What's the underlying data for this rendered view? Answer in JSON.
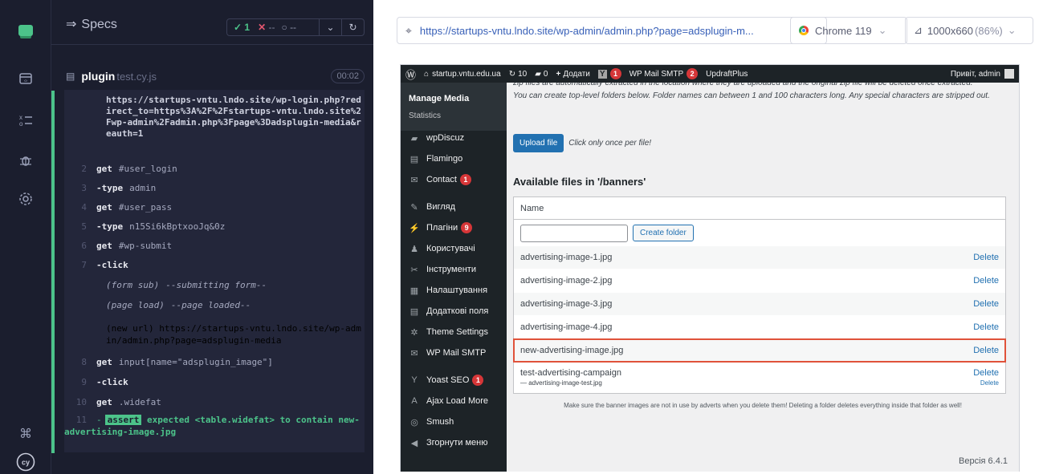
{
  "specs": {
    "title": "Specs",
    "passed": "1",
    "failed": "--",
    "pending": "--",
    "file_name": "plugin",
    "file_ext": "test.cy.js",
    "duration": "00:02",
    "redirect_text": "https://startups-vntu.lndo.site/wp-login.php?redirect_to=https%3A%2F%2Fstartups-vntu.lndo.site%2Fwp-admin%2Fadmin.php%3Fpage%3Dadsplugin-media&reauth=1",
    "commands": [
      {
        "num": "2",
        "name": "get",
        "value": "#user_login"
      },
      {
        "num": "3",
        "name": "-type",
        "value": "admin"
      },
      {
        "num": "4",
        "name": "get",
        "value": "#user_pass"
      },
      {
        "num": "5",
        "name": "-type",
        "value": "n15Si6kBptxooJq&0z"
      },
      {
        "num": "6",
        "name": "get",
        "value": "#wp-submit"
      },
      {
        "num": "7",
        "name": "-click",
        "value": ""
      },
      {
        "num": "",
        "name": "(form sub)",
        "value": "--submitting form--"
      },
      {
        "num": "",
        "name": "(page load)",
        "value": "--page loaded--"
      },
      {
        "num": "",
        "name": "(new url)",
        "value": "https://startups-vntu.lndo.site/wp-admin/admin.php?page=adsplugin-media"
      },
      {
        "num": "8",
        "name": "get",
        "value": "input[name=\"adsplugin_image\"]"
      },
      {
        "num": "9",
        "name": "-click",
        "value": ""
      },
      {
        "num": "10",
        "name": "get",
        "value": ".widefat"
      },
      {
        "num": "11",
        "name": "-",
        "badge": "assert",
        "value": "expected <table.widefat> to contain new-advertising-image.jpg"
      }
    ]
  },
  "browser": {
    "url": "https://startups-vntu.lndo.site/wp-admin/admin.php?page=adsplugin-m...",
    "browser_name": "Chrome 119",
    "viewport": "1000x660",
    "zoom": "(86%)"
  },
  "wp": {
    "adminbar": {
      "site": "startup.vntu.edu.ua",
      "updates": "10",
      "comments": "0",
      "add_new": "Додати",
      "yoast_count": "1",
      "smtp": "WP Mail SMTP",
      "smtp_count": "2",
      "updraft": "UpdraftPlus",
      "greeting": "Привіт, admin"
    },
    "menu": {
      "manage_media": "Manage Media",
      "statistics": "Statistics",
      "items": [
        {
          "label": "wpDiscuz",
          "icon": "comment-icon",
          "glyph": "▰"
        },
        {
          "label": "Flamingo",
          "icon": "flamingo-icon",
          "glyph": "▤"
        },
        {
          "label": "Contact",
          "icon": "mail-icon",
          "glyph": "✉",
          "badge": "1"
        },
        {
          "label": "Вигляд",
          "icon": "brush-icon",
          "glyph": "✎"
        },
        {
          "label": "Плагіни",
          "icon": "plugin-icon",
          "glyph": "⚡",
          "badge": "9"
        },
        {
          "label": "Користувачі",
          "icon": "users-icon",
          "glyph": "♟"
        },
        {
          "label": "Інструменти",
          "icon": "wrench-icon",
          "glyph": "✂"
        },
        {
          "label": "Налаштування",
          "icon": "settings-icon",
          "glyph": "▦"
        },
        {
          "label": "Додаткові поля",
          "icon": "fields-icon",
          "glyph": "▤"
        },
        {
          "label": "Theme Settings",
          "icon": "gear-icon",
          "glyph": "✲"
        },
        {
          "label": "WP Mail SMTP",
          "icon": "smtp-icon",
          "glyph": "✉"
        },
        {
          "label": "Yoast SEO",
          "icon": "yoast-icon",
          "glyph": "Y",
          "badge": "1"
        },
        {
          "label": "Ajax Load More",
          "icon": "ajax-icon",
          "glyph": "A"
        },
        {
          "label": "Smush",
          "icon": "smush-icon",
          "glyph": "◎"
        },
        {
          "label": "Згорнути меню",
          "icon": "collapse-icon",
          "glyph": "◀"
        }
      ]
    },
    "intro_line1": "zip files are automatically extracted in the location where they are uploaded and the original zip file will be deleted once extracted.",
    "intro_line2": "You can create top-level folders below. Folder names can between 1 and 100 characters long. Any special characters are stripped out.",
    "upload_btn": "Upload file",
    "upload_note": "Click only once per file!",
    "files_heading": "Available files in '/banners'",
    "col_name": "Name",
    "create_folder": "Create folder",
    "delete_label": "Delete",
    "files": [
      "advertising-image-1.jpg",
      "advertising-image-2.jpg",
      "advertising-image-3.jpg",
      "advertising-image-4.jpg",
      "new-advertising-image.jpg",
      "test-advertising-campaign"
    ],
    "subfile": "— advertising-image-test.jpg",
    "footer_note": "Make sure the banner images are not in use by adverts when you delete them! Deleting a folder deletes everything inside that folder as well!",
    "version": "Версія 6.4.1"
  }
}
